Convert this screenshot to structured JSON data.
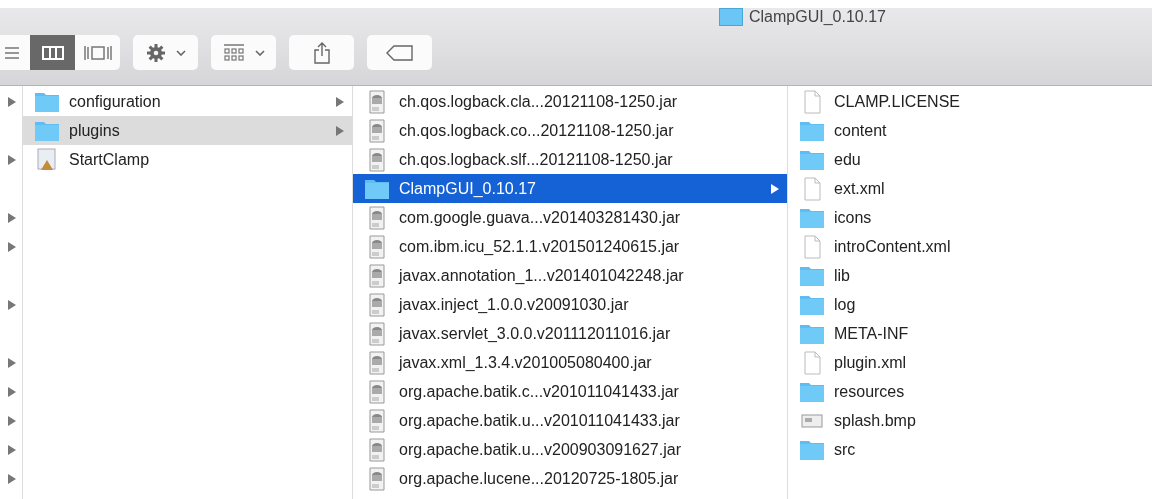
{
  "window": {
    "title": "ClampGUI_0.10.17"
  },
  "toolbar": {
    "views": [
      {
        "kind": "list",
        "selected": false
      },
      {
        "kind": "columns",
        "selected": true
      },
      {
        "kind": "coverflow",
        "selected": false
      }
    ],
    "buttons": [
      {
        "kind": "action",
        "menu": true
      },
      {
        "kind": "arrange",
        "menu": true
      },
      {
        "kind": "share",
        "menu": false
      },
      {
        "kind": "tag",
        "menu": false
      }
    ]
  },
  "cut_column": {
    "rows": [
      {
        "expandable": true
      },
      {
        "expandable": false
      },
      {
        "expandable": true
      },
      {
        "expandable": false
      },
      {
        "expandable": true
      },
      {
        "expandable": true
      },
      {
        "expandable": false
      },
      {
        "expandable": true
      },
      {
        "expandable": false
      },
      {
        "expandable": true
      },
      {
        "expandable": true
      },
      {
        "expandable": true
      },
      {
        "expandable": true
      },
      {
        "expandable": true
      }
    ]
  },
  "columns": [
    {
      "focused": false,
      "items": [
        {
          "name": "configuration",
          "kind": "folder",
          "expandable": true,
          "selected": false
        },
        {
          "name": "plugins",
          "kind": "folder",
          "expandable": true,
          "selected": true
        },
        {
          "name": "StartClamp",
          "kind": "app",
          "expandable": false,
          "selected": false
        }
      ]
    },
    {
      "focused": true,
      "items": [
        {
          "name": "ch.qos.logback.cla...20121108-1250.jar",
          "kind": "jar",
          "expandable": false,
          "selected": false
        },
        {
          "name": "ch.qos.logback.co...20121108-1250.jar",
          "kind": "jar",
          "expandable": false,
          "selected": false
        },
        {
          "name": "ch.qos.logback.slf...20121108-1250.jar",
          "kind": "jar",
          "expandable": false,
          "selected": false
        },
        {
          "name": "ClampGUI_0.10.17",
          "kind": "folder",
          "expandable": true,
          "selected": true
        },
        {
          "name": "com.google.guava...v201403281430.jar",
          "kind": "jar",
          "expandable": false,
          "selected": false
        },
        {
          "name": "com.ibm.icu_52.1.1.v201501240615.jar",
          "kind": "jar",
          "expandable": false,
          "selected": false
        },
        {
          "name": "javax.annotation_1...v201401042248.jar",
          "kind": "jar",
          "expandable": false,
          "selected": false
        },
        {
          "name": "javax.inject_1.0.0.v20091030.jar",
          "kind": "jar",
          "expandable": false,
          "selected": false
        },
        {
          "name": "javax.servlet_3.0.0.v201112011016.jar",
          "kind": "jar",
          "expandable": false,
          "selected": false
        },
        {
          "name": "javax.xml_1.3.4.v201005080400.jar",
          "kind": "jar",
          "expandable": false,
          "selected": false
        },
        {
          "name": "org.apache.batik.c...v201011041433.jar",
          "kind": "jar",
          "expandable": false,
          "selected": false
        },
        {
          "name": "org.apache.batik.u...v201011041433.jar",
          "kind": "jar",
          "expandable": false,
          "selected": false
        },
        {
          "name": "org.apache.batik.u...v200903091627.jar",
          "kind": "jar",
          "expandable": false,
          "selected": false
        },
        {
          "name": "org.apache.lucene...20120725-1805.jar",
          "kind": "jar",
          "expandable": false,
          "selected": false
        }
      ]
    },
    {
      "items": [
        {
          "name": "CLAMP.LICENSE",
          "kind": "file",
          "expandable": false,
          "selected": false
        },
        {
          "name": "content",
          "kind": "folder",
          "expandable": false,
          "selected": false
        },
        {
          "name": "edu",
          "kind": "folder",
          "expandable": false,
          "selected": false
        },
        {
          "name": "ext.xml",
          "kind": "file",
          "expandable": false,
          "selected": false
        },
        {
          "name": "icons",
          "kind": "folder",
          "expandable": false,
          "selected": false
        },
        {
          "name": "introContent.xml",
          "kind": "file",
          "expandable": false,
          "selected": false
        },
        {
          "name": "lib",
          "kind": "folder",
          "expandable": false,
          "selected": false
        },
        {
          "name": "log",
          "kind": "folder",
          "expandable": false,
          "selected": false
        },
        {
          "name": "META-INF",
          "kind": "folder",
          "expandable": false,
          "selected": false
        },
        {
          "name": "plugin.xml",
          "kind": "file",
          "expandable": false,
          "selected": false
        },
        {
          "name": "resources",
          "kind": "folder",
          "expandable": false,
          "selected": false
        },
        {
          "name": "splash.bmp",
          "kind": "image",
          "expandable": false,
          "selected": false
        },
        {
          "name": "src",
          "kind": "folder",
          "expandable": false,
          "selected": false
        }
      ]
    }
  ]
}
